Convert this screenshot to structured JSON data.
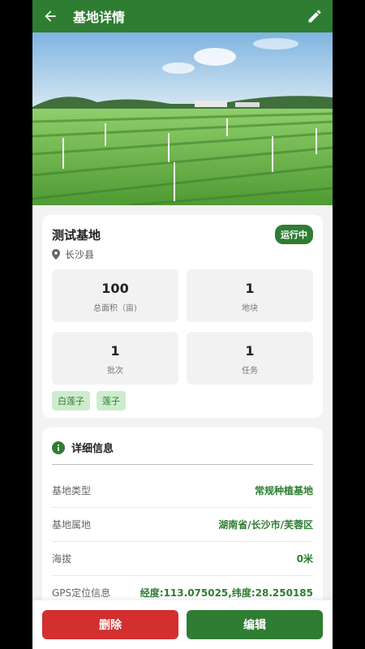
{
  "appbar": {
    "title": "基地详情",
    "back_icon": "arrow-left-icon",
    "edit_icon": "pencil-icon"
  },
  "base": {
    "name": "测试基地",
    "status": "运行中",
    "location": "长沙县",
    "stats": [
      {
        "value": "100",
        "label": "总面积（亩)"
      },
      {
        "value": "1",
        "label": "地块"
      },
      {
        "value": "1",
        "label": "批次"
      },
      {
        "value": "1",
        "label": "任务"
      }
    ],
    "tags": [
      "白莲子",
      "莲子"
    ]
  },
  "details": {
    "title": "详细信息",
    "rows": [
      {
        "key": "基地类型",
        "value": "常规种植基地"
      },
      {
        "key": "基地属地",
        "value": "湖南省/长沙市/芙蓉区"
      },
      {
        "key": "海拔",
        "value": "0米"
      },
      {
        "key": "GPS定位信息",
        "value": "经度:113.075025,纬度:28.250185"
      }
    ]
  },
  "actions": {
    "delete_label": "删除",
    "edit_label": "编辑"
  },
  "colors": {
    "primary": "#2e7d32",
    "danger": "#d32f2f",
    "tag_bg": "#cdeccd"
  }
}
